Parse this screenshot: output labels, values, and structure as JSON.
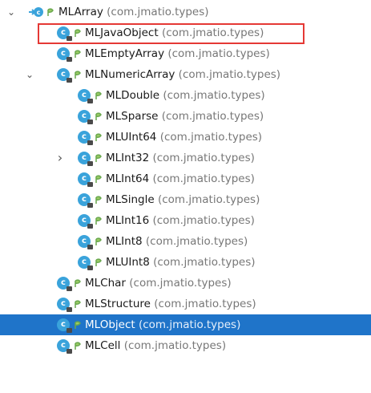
{
  "tree": {
    "items": [
      {
        "name": "MLArray",
        "package": "(com.jmatio.types)",
        "level": 0,
        "expander": "expanded",
        "icon": "abstract-class-icon"
      },
      {
        "name": "MLJavaObject",
        "package": "(com.jmatio.types)",
        "level": 1,
        "expander": "none",
        "icon": "class-icon",
        "highlighted": true
      },
      {
        "name": "MLEmptyArray",
        "package": "(com.jmatio.types)",
        "level": 1,
        "expander": "none",
        "icon": "class-icon"
      },
      {
        "name": "MLNumericArray",
        "package": "(com.jmatio.types)",
        "level": 1,
        "expander": "expanded",
        "icon": "class-icon"
      },
      {
        "name": "MLDouble",
        "package": "(com.jmatio.types)",
        "level": 2,
        "expander": "none",
        "icon": "class-icon"
      },
      {
        "name": "MLSparse",
        "package": "(com.jmatio.types)",
        "level": 2,
        "expander": "none",
        "icon": "class-icon"
      },
      {
        "name": "MLUInt64",
        "package": "(com.jmatio.types)",
        "level": 2,
        "expander": "none",
        "icon": "class-icon"
      },
      {
        "name": "MLInt32",
        "package": "(com.jmatio.types)",
        "level": 2,
        "expander": "collapsed",
        "icon": "class-icon"
      },
      {
        "name": "MLInt64",
        "package": "(com.jmatio.types)",
        "level": 2,
        "expander": "none",
        "icon": "class-icon"
      },
      {
        "name": "MLSingle",
        "package": "(com.jmatio.types)",
        "level": 2,
        "expander": "none",
        "icon": "class-icon"
      },
      {
        "name": "MLInt16",
        "package": "(com.jmatio.types)",
        "level": 2,
        "expander": "none",
        "icon": "class-icon"
      },
      {
        "name": "MLInt8",
        "package": "(com.jmatio.types)",
        "level": 2,
        "expander": "none",
        "icon": "class-icon"
      },
      {
        "name": "MLUInt8",
        "package": "(com.jmatio.types)",
        "level": 2,
        "expander": "none",
        "icon": "class-icon"
      },
      {
        "name": "MLChar",
        "package": "(com.jmatio.types)",
        "level": 1,
        "expander": "none",
        "icon": "class-icon"
      },
      {
        "name": "MLStructure",
        "package": "(com.jmatio.types)",
        "level": 1,
        "expander": "none",
        "icon": "class-icon"
      },
      {
        "name": "MLObject",
        "package": "(com.jmatio.types)",
        "level": 1,
        "expander": "none",
        "icon": "class-icon",
        "selected": true
      },
      {
        "name": "MLCell",
        "package": "(com.jmatio.types)",
        "level": 1,
        "expander": "none",
        "icon": "class-icon"
      }
    ]
  },
  "colors": {
    "selection": "#1f74c9",
    "highlight_border": "#e53935",
    "class_icon": "#3aa3db",
    "package_text": "#777777"
  }
}
